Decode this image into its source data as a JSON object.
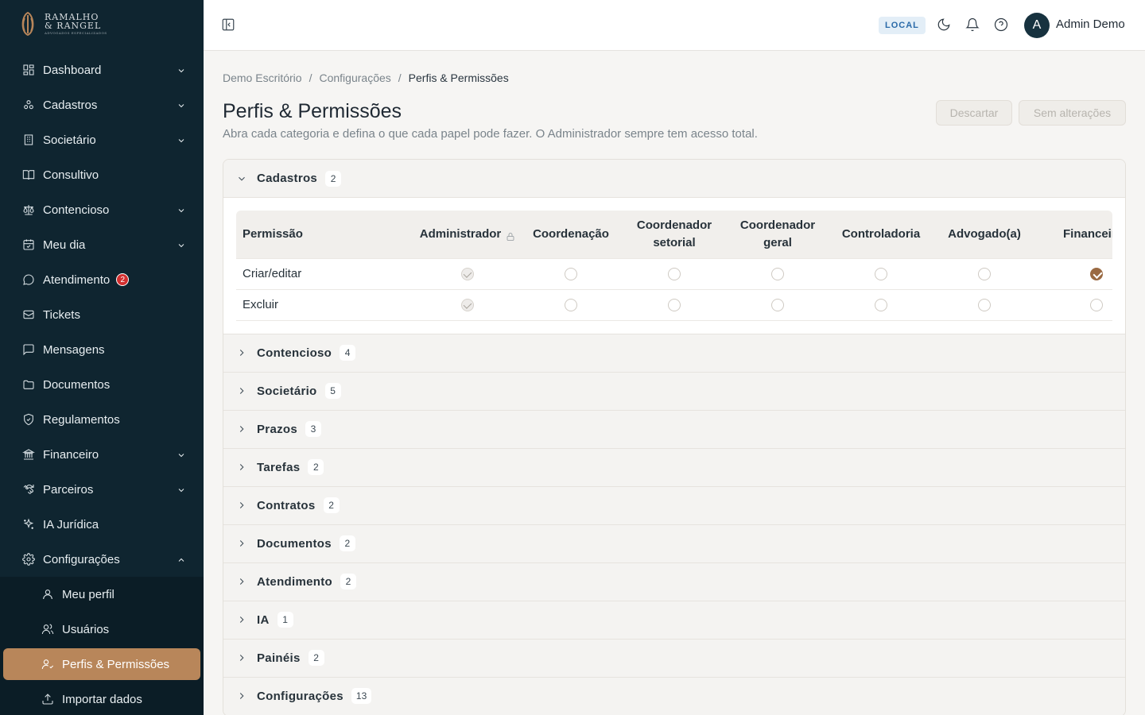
{
  "brand": {
    "line1": "RAMALHO",
    "line2": "& RANGEL",
    "line3": "ADVOGADOS ESPECIALIZADOS"
  },
  "sidebar": {
    "items": [
      {
        "label": "Dashboard",
        "icon": "dashboard-icon",
        "expandable": true
      },
      {
        "label": "Cadastros",
        "icon": "cadastros-icon",
        "expandable": true
      },
      {
        "label": "Societário",
        "icon": "building-icon",
        "expandable": true
      },
      {
        "label": "Consultivo",
        "icon": "book-icon",
        "expandable": false
      },
      {
        "label": "Contencioso",
        "icon": "scale-icon",
        "expandable": true
      },
      {
        "label": "Meu dia",
        "icon": "calendar-icon",
        "expandable": true
      },
      {
        "label": "Atendimento",
        "icon": "chat-icon",
        "expandable": false,
        "badge": "2"
      },
      {
        "label": "Tickets",
        "icon": "ticket-icon",
        "expandable": false
      },
      {
        "label": "Mensagens",
        "icon": "message-icon",
        "expandable": false
      },
      {
        "label": "Documentos",
        "icon": "folder-icon",
        "expandable": false
      },
      {
        "label": "Regulamentos",
        "icon": "shield-icon",
        "expandable": false
      },
      {
        "label": "Financeiro",
        "icon": "bank-icon",
        "expandable": true
      },
      {
        "label": "Parceiros",
        "icon": "handshake-icon",
        "expandable": true
      },
      {
        "label": "IA Jurídica",
        "icon": "sparkle-icon",
        "expandable": false
      },
      {
        "label": "Configurações",
        "icon": "gear-icon",
        "expandable": true,
        "expanded": true
      }
    ],
    "subitems": [
      {
        "label": "Meu perfil",
        "icon": "user-icon",
        "active": false
      },
      {
        "label": "Usuários",
        "icon": "users-icon",
        "active": false
      },
      {
        "label": "Perfis & Permissões",
        "icon": "user-check-icon",
        "active": true
      },
      {
        "label": "Importar dados",
        "icon": "upload-icon",
        "active": false
      }
    ]
  },
  "topbar": {
    "env": "LOCAL",
    "user_initial": "A",
    "user_name": "Admin Demo"
  },
  "breadcrumb": [
    "Demo Escritório",
    "Configurações",
    "Perfis & Permissões"
  ],
  "page": {
    "title": "Perfis & Permissões",
    "subtitle": "Abra cada categoria e defina o que cada papel pode fazer. O Administrador sempre tem acesso total.",
    "discard_label": "Descartar",
    "save_label": "Sem alterações"
  },
  "permissions": {
    "open_section": {
      "label": "Cadastros",
      "count": "2"
    },
    "columns": [
      "Permissão",
      "Administrador",
      "Coordenação",
      "Coordenador setorial",
      "Coordenador geral",
      "Controladoria",
      "Advogado(a)",
      "Financeiro"
    ],
    "rows": [
      {
        "label": "Criar/editar",
        "values": [
          true,
          false,
          false,
          false,
          false,
          false,
          true
        ]
      },
      {
        "label": "Excluir",
        "values": [
          true,
          false,
          false,
          false,
          false,
          false,
          false
        ]
      }
    ],
    "sections": [
      {
        "label": "Contencioso",
        "count": "4"
      },
      {
        "label": "Societário",
        "count": "5"
      },
      {
        "label": "Prazos",
        "count": "3"
      },
      {
        "label": "Tarefas",
        "count": "2"
      },
      {
        "label": "Contratos",
        "count": "2"
      },
      {
        "label": "Documentos",
        "count": "2"
      },
      {
        "label": "Atendimento",
        "count": "2"
      },
      {
        "label": "IA",
        "count": "1"
      },
      {
        "label": "Painéis",
        "count": "2"
      },
      {
        "label": "Configurações",
        "count": "13"
      }
    ]
  },
  "colors": {
    "sidebar_bg": "#0f2530",
    "accent": "#b8865a",
    "checked": "#9a6a43",
    "badge": "#d32f2f"
  }
}
